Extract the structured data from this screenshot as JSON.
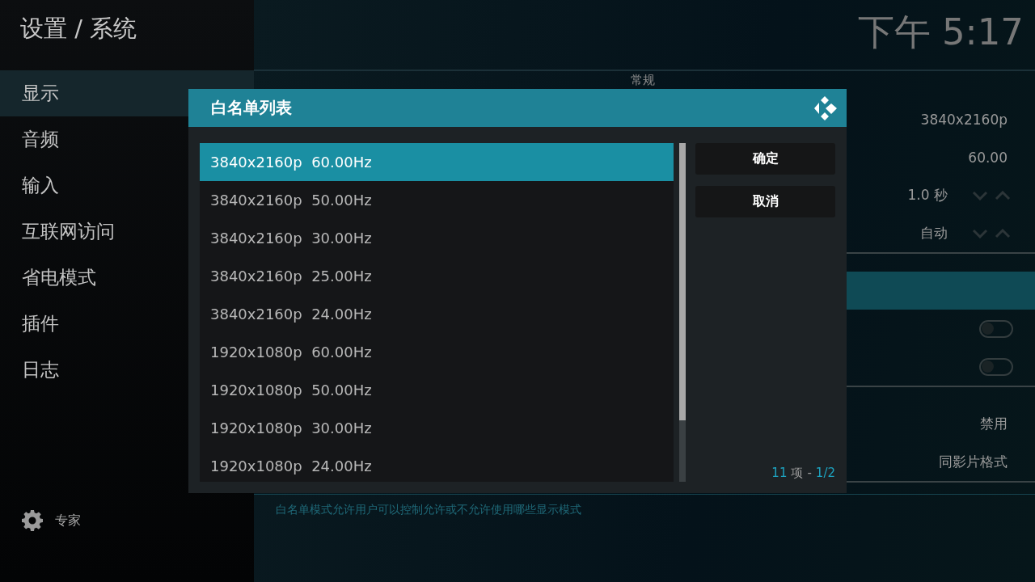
{
  "header": {
    "title": "设置 / 系统",
    "clock": "下午 5:17"
  },
  "sidebar": {
    "items": [
      {
        "label": "显示",
        "selected": true
      },
      {
        "label": "音频",
        "selected": false
      },
      {
        "label": "输入",
        "selected": false
      },
      {
        "label": "互联网访问",
        "selected": false
      },
      {
        "label": "省电模式",
        "selected": false
      },
      {
        "label": "插件",
        "selected": false
      },
      {
        "label": "日志",
        "selected": false
      }
    ],
    "footer": {
      "label": "专家"
    }
  },
  "settings": {
    "sections": [
      {
        "title": "常规",
        "rows": [
          {
            "kind": "value",
            "value": "3840x2160p",
            "selected": false
          },
          {
            "kind": "value",
            "value": "60.00",
            "selected": false
          },
          {
            "kind": "spinner",
            "value": "1.0 秒",
            "selected": false
          },
          {
            "kind": "spinner",
            "value": "自动",
            "selected": false
          }
        ]
      },
      {
        "rows": [
          {
            "kind": "blank",
            "selected": true
          },
          {
            "kind": "toggle",
            "on": false,
            "selected": false
          },
          {
            "kind": "toggle",
            "on": false,
            "selected": false
          }
        ]
      },
      {
        "rows": [
          {
            "kind": "value",
            "value": "禁用",
            "selected": false
          },
          {
            "kind": "value",
            "value": "同影片格式",
            "selected": false
          }
        ]
      }
    ],
    "description": "白名单模式允许用户可以控制允许或不允许使用哪些显示模式"
  },
  "dialog": {
    "title": "白名单列表",
    "items": [
      {
        "label": "3840x2160p  60.00Hz",
        "selected": true
      },
      {
        "label": "3840x2160p  50.00Hz",
        "selected": false
      },
      {
        "label": "3840x2160p  30.00Hz",
        "selected": false
      },
      {
        "label": "3840x2160p  25.00Hz",
        "selected": false
      },
      {
        "label": "3840x2160p  24.00Hz",
        "selected": false
      },
      {
        "label": "1920x1080p  60.00Hz",
        "selected": false
      },
      {
        "label": "1920x1080p  50.00Hz",
        "selected": false
      },
      {
        "label": "1920x1080p  30.00Hz",
        "selected": false
      },
      {
        "label": "1920x1080p  24.00Hz",
        "selected": false
      }
    ],
    "buttons": [
      "确定",
      "取消"
    ],
    "footer": {
      "count": "11",
      "unit": "项",
      "separator": "-",
      "page": "1/2"
    }
  }
}
